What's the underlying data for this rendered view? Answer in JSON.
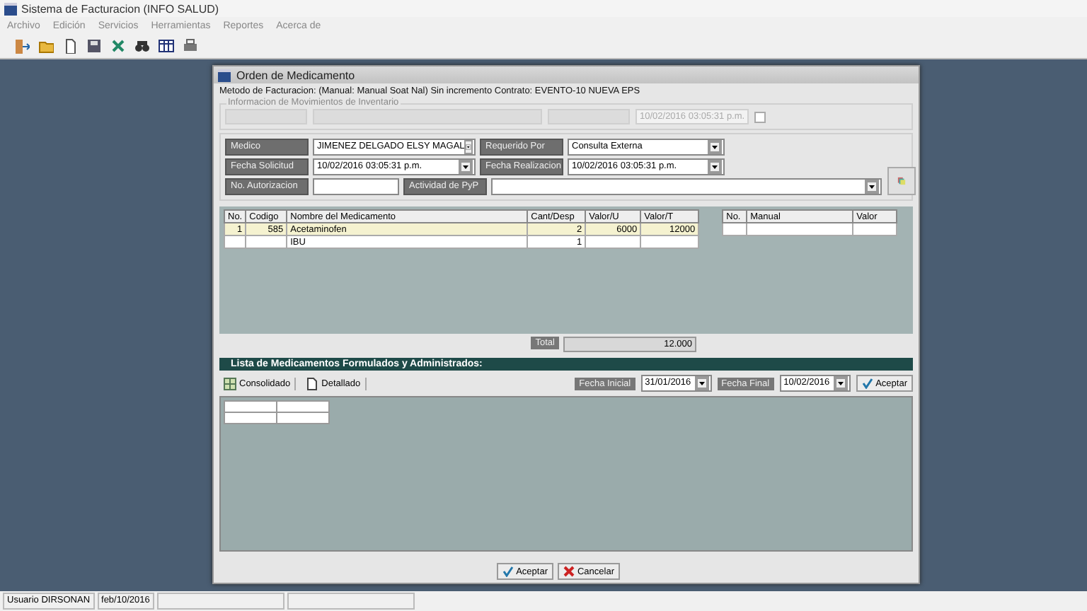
{
  "window": {
    "title": "Sistema de Facturacion (INFO SALUD)"
  },
  "menu": [
    "Archivo",
    "Edición",
    "Servicios",
    "Herramientas",
    "Reportes",
    "Acerca de"
  ],
  "dialog": {
    "title": "Orden de Medicamento",
    "billing_method": "Metodo de Facturacion: (Manual: Manual Soat Nal) Sin incremento Contrato: EVENTO-10 NUEVA EPS",
    "inventory": {
      "legend": "Informacion de Movimientos de Inventario",
      "movement_date": "10/02/2016 03:05:31 p.m.",
      "discharge_checked": false
    },
    "form_rows": [
      [
        {
          "label": "Medico",
          "value": "JIMENEZ DELGADO ELSY MAGAL",
          "kind": "select"
        },
        {
          "label": "Requerido Por",
          "value": "Consulta Externa",
          "kind": "select"
        }
      ],
      [
        {
          "label": "Fecha Solicitud",
          "value": "10/02/2016 03:05:31 p.m.",
          "kind": "select"
        },
        {
          "label": "Fecha Realizacion",
          "value": "10/02/2016 03:05:31 p.m.",
          "kind": "select"
        }
      ],
      [
        {
          "label": "No. Autorizacion",
          "kind": "input"
        },
        {
          "label": "Actividad de PyP",
          "kind": "wide-select"
        }
      ]
    ],
    "items_table": {
      "columns": [
        "No.",
        "Codigo",
        "Nombre del Medicamento",
        "Cant/Desp",
        "Valor/U",
        "Valor/T"
      ],
      "rows": [
        {
          "cells": [
            "1",
            "585",
            "Acetaminofen",
            "2",
            "6000",
            "12000"
          ],
          "selected": true
        },
        {
          "cells": [
            "",
            "",
            "IBU",
            "1",
            "",
            ""
          ],
          "selected": false
        }
      ]
    },
    "manual_table": {
      "columns": [
        "No.",
        "Manual",
        "Valor"
      ]
    },
    "total": {
      "label": "Total",
      "value": "12.000"
    },
    "list": {
      "title": "Lista de Medicamentos Formulados y Administrados:",
      "views": [
        {
          "label": "Consolidado",
          "kind": "consolidated"
        },
        {
          "label": "Detallado",
          "kind": "detailed"
        }
      ],
      "start": {
        "label": "Fecha Inicial",
        "value": "31/01/2016"
      },
      "end": {
        "label": "Fecha Final",
        "value": "10/02/2016"
      },
      "apply": "Aceptar"
    },
    "buttons": [
      {
        "label": "Aceptar",
        "kind": "accept"
      },
      {
        "label": "Cancelar",
        "kind": "cancel"
      }
    ]
  },
  "status_bar": [
    "Usuario DIRSONAN",
    "feb/10/2016"
  ]
}
